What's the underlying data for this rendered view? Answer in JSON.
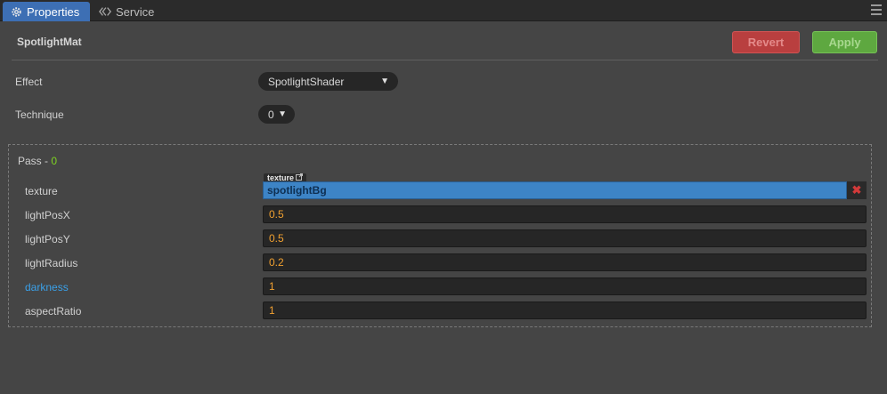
{
  "tabs": [
    {
      "label": "Properties",
      "icon": "gear-icon",
      "active": true
    },
    {
      "label": "Service",
      "icon": "service-icon",
      "active": false
    }
  ],
  "header": {
    "title": "SpotlightMat",
    "revert_label": "Revert",
    "apply_label": "Apply"
  },
  "effect": {
    "label": "Effect",
    "value": "SpotlightShader"
  },
  "technique": {
    "label": "Technique",
    "value": "0"
  },
  "pass": {
    "title": "Pass - ",
    "index": "0",
    "texture": {
      "label": "texture",
      "tag": "texture",
      "value": "spotlightBg"
    },
    "props": [
      {
        "label": "lightPosX",
        "value": "0.5"
      },
      {
        "label": "lightPosY",
        "value": "0.5"
      },
      {
        "label": "lightRadius",
        "value": "0.2"
      },
      {
        "label": "darkness",
        "value": "1"
      },
      {
        "label": "aspectRatio",
        "value": "1"
      }
    ]
  },
  "colors": {
    "accent": "#3d6fb4",
    "revert": "#b93f3f",
    "apply": "#5ea840",
    "number": "#f0a030",
    "pass_index": "#7ed321",
    "highlight_label": "#3aa0e8"
  }
}
